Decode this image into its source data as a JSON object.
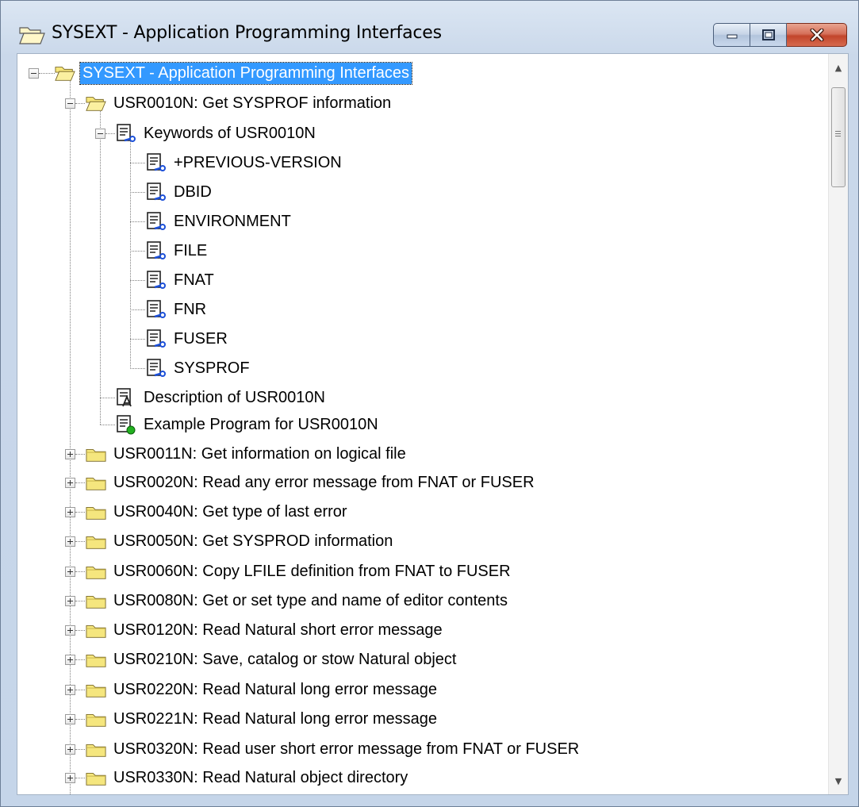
{
  "window": {
    "title": "SYSEXT - Application Programming Interfaces"
  },
  "tree": {
    "root": "SYSEXT - Application Programming Interfaces",
    "usr0010n": "USR0010N: Get SYSPROF information",
    "keywords_node": "Keywords of USR0010N",
    "keywords": [
      "+PREVIOUS-VERSION",
      "DBID",
      "ENVIRONMENT",
      "FILE",
      "FNAT",
      "FNR",
      "FUSER",
      "SYSPROF"
    ],
    "description": "Description of USR0010N",
    "example": "Example Program for USR0010N",
    "folders": [
      "USR0011N: Get information on logical file",
      "USR0020N: Read any error message from FNAT or FUSER",
      "USR0040N: Get type of last error",
      "USR0050N: Get SYSPROD information",
      "USR0060N: Copy LFILE definition from FNAT to FUSER",
      "USR0080N: Get or set type and name of editor contents",
      "USR0120N: Read Natural short error message",
      "USR0210N: Save, catalog or stow Natural object",
      "USR0220N: Read Natural long error message",
      "USR0221N: Read Natural long error message",
      "USR0320N: Read user short error message from FNAT or FUSER",
      "USR0330N: Read Natural object directory"
    ]
  },
  "colors": {
    "selection": "#3399ff",
    "folder": "#f5e67e",
    "close_button": "#c2452b",
    "tree_lines": "#808080"
  }
}
